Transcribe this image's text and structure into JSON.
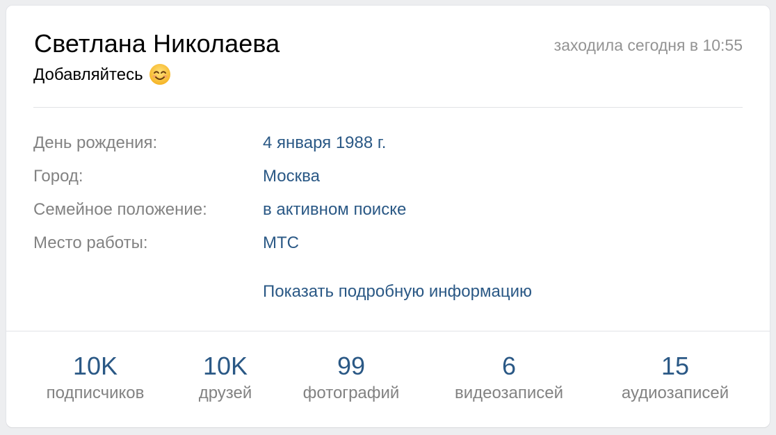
{
  "profile": {
    "name": "Светлана Николаева",
    "last_seen": "заходила сегодня в 10:55",
    "status_text": "Добавляйтесь",
    "status_emoji": "smiling-face-icon"
  },
  "info": {
    "rows": [
      {
        "label": "День рождения:",
        "value": "4 января 1988 г."
      },
      {
        "label": "Город:",
        "value": "Москва"
      },
      {
        "label": "Семейное положение:",
        "value": "в активном поиске"
      },
      {
        "label": "Место работы:",
        "value": "МТС"
      }
    ],
    "more_link": "Показать подробную информацию"
  },
  "counters": [
    {
      "value": "10K",
      "label": "подписчиков"
    },
    {
      "value": "10K",
      "label": "друзей"
    },
    {
      "value": "99",
      "label": "фотографий"
    },
    {
      "value": "6",
      "label": "видеозаписей"
    },
    {
      "value": "15",
      "label": "аудиозаписей"
    }
  ],
  "colors": {
    "background": "#edeef0",
    "card": "#ffffff",
    "link": "#2a5885",
    "muted": "#828282",
    "last_seen": "#939393",
    "divider": "#e1e3e6"
  }
}
